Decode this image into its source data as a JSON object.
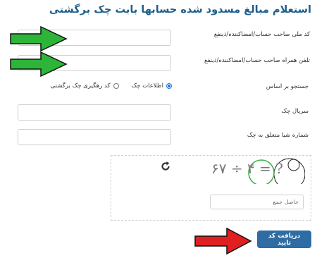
{
  "form": {
    "title": "استعلام مبالغ مسدود شده حسابها بابت چک برگشتی",
    "national_code": {
      "label": "کد ملی صاحب حساب/امضاکننده/ذینفع",
      "value": ""
    },
    "mobile": {
      "label": "تلفن همراه صاحب حساب/امضاکننده/ذینفع",
      "value": ""
    },
    "search_basis": {
      "label": "جستجو بر اساس",
      "options": [
        "اطلاعات چک",
        "کد رهگیری چک برگشتی"
      ],
      "selected": "اطلاعات چک"
    },
    "cheque_serial": {
      "label": "سریال چک",
      "value": ""
    },
    "sheba": {
      "label": "شماره شبا متعلق به چک",
      "value": ""
    },
    "captcha": {
      "image_text": "۶۷ ÷ ۴ = ?",
      "refresh_icon": "refresh-icon",
      "answer_placeholder": "حاصل جمع"
    },
    "submit_label": "دریافت کد تایید"
  },
  "annotations": {
    "green_arrow_color": "#2db53a",
    "red_arrow_color": "#e02020"
  }
}
